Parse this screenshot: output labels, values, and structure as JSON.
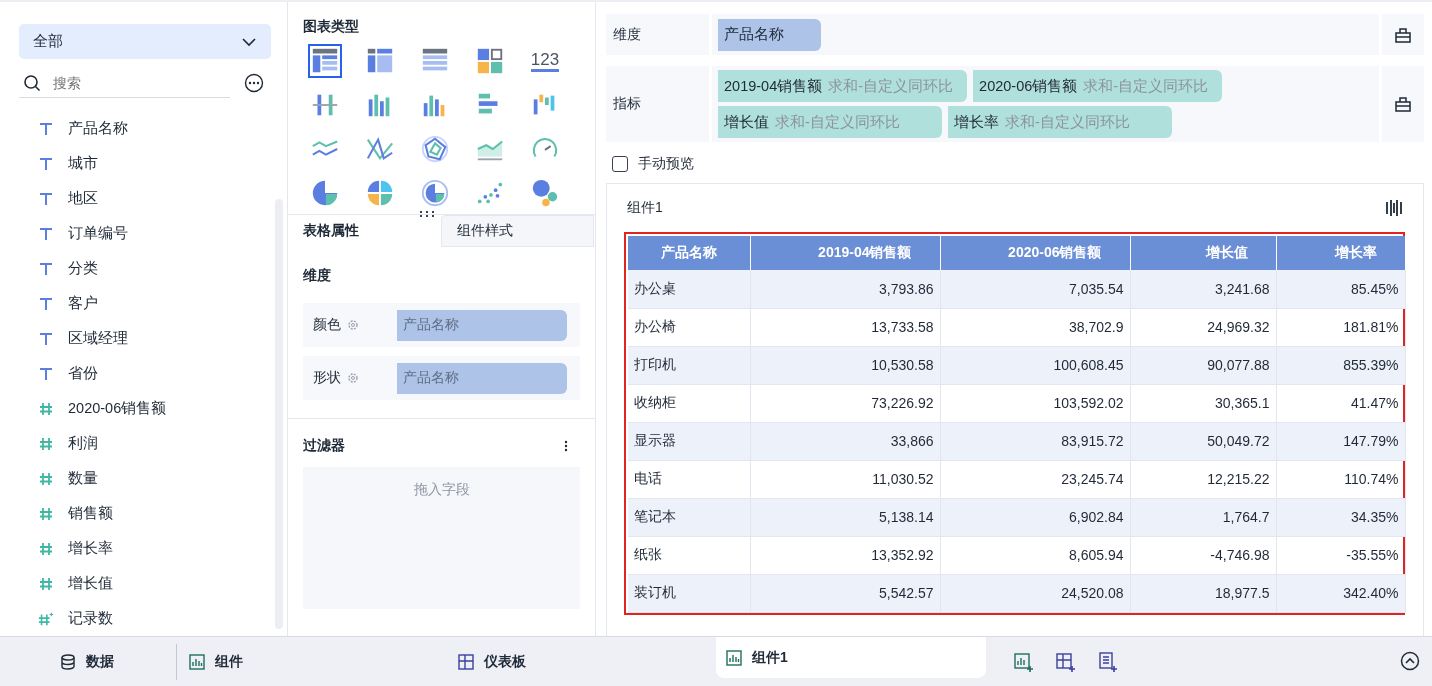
{
  "field_panel": {
    "dropdown": {
      "value": "全部"
    },
    "search": {
      "placeholder": "搜索"
    },
    "fields": [
      {
        "name": "产品名称",
        "kind": "text"
      },
      {
        "name": "城市",
        "kind": "text"
      },
      {
        "name": "地区",
        "kind": "text"
      },
      {
        "name": "订单编号",
        "kind": "text"
      },
      {
        "name": "分类",
        "kind": "text"
      },
      {
        "name": "客户",
        "kind": "text"
      },
      {
        "name": "区域经理",
        "kind": "text"
      },
      {
        "name": "省份",
        "kind": "text"
      },
      {
        "name": "2020-06销售额",
        "kind": "number"
      },
      {
        "name": "利润",
        "kind": "number"
      },
      {
        "name": "数量",
        "kind": "number"
      },
      {
        "name": "销售额",
        "kind": "number"
      },
      {
        "name": "增长率",
        "kind": "number"
      },
      {
        "name": "增长值",
        "kind": "number"
      },
      {
        "name": "记录数",
        "kind": "count"
      }
    ]
  },
  "chart_types": {
    "title": "图表类型",
    "items": [
      {
        "kind": "grouped-table",
        "selected": true
      },
      {
        "kind": "cross-table",
        "selected": false
      },
      {
        "kind": "detail-table",
        "selected": false
      },
      {
        "kind": "blocks",
        "selected": false
      },
      {
        "kind": "kpi",
        "label": "123",
        "selected": false
      },
      {
        "kind": "range",
        "selected": false
      },
      {
        "kind": "stacked-bars",
        "selected": false
      },
      {
        "kind": "bars",
        "selected": false
      },
      {
        "kind": "hbars",
        "selected": false
      },
      {
        "kind": "waterfall",
        "selected": false
      },
      {
        "kind": "lines",
        "selected": false
      },
      {
        "kind": "cross-lines",
        "selected": false
      },
      {
        "kind": "radar",
        "selected": false
      },
      {
        "kind": "area",
        "selected": false
      },
      {
        "kind": "gauge",
        "selected": false
      },
      {
        "kind": "pie",
        "selected": false
      },
      {
        "kind": "multi-pie",
        "selected": false
      },
      {
        "kind": "ring",
        "selected": false
      },
      {
        "kind": "scatter",
        "selected": false
      },
      {
        "kind": "bubbles",
        "selected": false
      }
    ]
  },
  "property_tabs": [
    {
      "label": "表格属性",
      "selected": true
    },
    {
      "label": "组件样式",
      "selected": false
    }
  ],
  "properties": {
    "section": "维度",
    "rows": [
      {
        "label": "颜色",
        "value": "产品名称"
      },
      {
        "label": "形状",
        "value": "产品名称"
      }
    ]
  },
  "filter": {
    "title": "过滤器",
    "dropzone": "拖入字段"
  },
  "dimension": {
    "label": "维度",
    "chips": [
      {
        "name": "产品名称"
      }
    ]
  },
  "measure": {
    "label": "指标",
    "chips": [
      {
        "name": "2019-04销售额",
        "aggregation": "求和-自定义同环比"
      },
      {
        "name": "2020-06销售额",
        "aggregation": "求和-自定义同环比"
      },
      {
        "name": "增长值",
        "aggregation": "求和-自定义同环比"
      },
      {
        "name": "增长率",
        "aggregation": "求和-自定义同环比"
      }
    ]
  },
  "manual_preview": {
    "label": "手动预览",
    "checked": false
  },
  "component": {
    "title": "组件1",
    "table": {
      "columns": [
        "产品名称",
        "2019-04销售额",
        "2020-06销售额",
        "增长值",
        "增长率"
      ],
      "rows": [
        [
          "办公桌",
          "3,793.86",
          "7,035.54",
          "3,241.68",
          "85.45%"
        ],
        [
          "办公椅",
          "13,733.58",
          "38,702.9",
          "24,969.32",
          "181.81%"
        ],
        [
          "打印机",
          "10,530.58",
          "100,608.45",
          "90,077.88",
          "855.39%"
        ],
        [
          "收纳柜",
          "73,226.92",
          "103,592.02",
          "30,365.1",
          "41.47%"
        ],
        [
          "显示器",
          "33,866",
          "83,915.72",
          "50,049.72",
          "147.79%"
        ],
        [
          "电话",
          "11,030.52",
          "23,245.74",
          "12,215.22",
          "110.74%"
        ],
        [
          "笔记本",
          "5,138.14",
          "6,902.84",
          "1,764.7",
          "34.35%"
        ],
        [
          "纸张",
          "13,352.92",
          "8,605.94",
          "-4,746.98",
          "-35.55%"
        ],
        [
          "装订机",
          "5,542.57",
          "24,520.08",
          "18,977.5",
          "342.40%"
        ]
      ]
    }
  },
  "bottom_tabs": [
    {
      "label": "数据",
      "kind": "data",
      "selected": false
    },
    {
      "label": "组件",
      "kind": "chart",
      "selected": false
    },
    {
      "label": "仪表板",
      "kind": "dashboard",
      "selected": false
    },
    {
      "label": "组件1",
      "kind": "chart",
      "selected": true
    }
  ]
}
